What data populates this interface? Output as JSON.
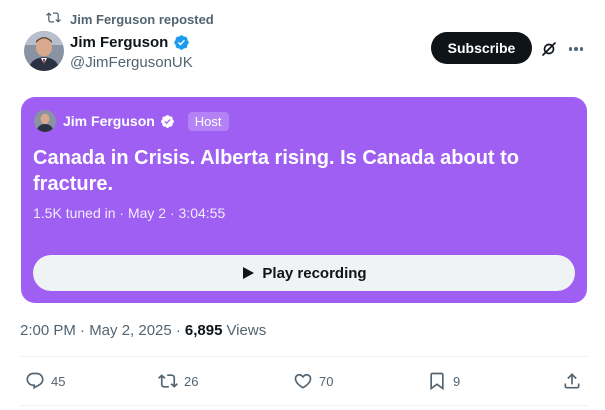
{
  "repost": {
    "text": "Jim Ferguson reposted",
    "icon": "repost-icon"
  },
  "author": {
    "name": "Jim Ferguson",
    "handle": "@JimFergusonUK",
    "verified": true,
    "verified_color": "#1d9bf0"
  },
  "header_actions": {
    "subscribe_label": "Subscribe",
    "grok_icon": "grok-icon",
    "more_icon": "more-icon"
  },
  "space": {
    "card_color": "#9e5ff2",
    "host_name": "Jim Ferguson",
    "host_badge": "Host",
    "title": "Canada in Crisis. Alberta rising. Is Canada about to fracture.",
    "meta": "1.5K tuned in · May 2 · 3:04:55",
    "play_label": "Play recording"
  },
  "post_meta": {
    "time": "2:00 PM · May 2, 2025 ·",
    "views_count": "6,895",
    "views_label": "Views"
  },
  "actions": {
    "replies": "45",
    "reposts": "26",
    "likes": "70",
    "bookmarks": "9"
  }
}
